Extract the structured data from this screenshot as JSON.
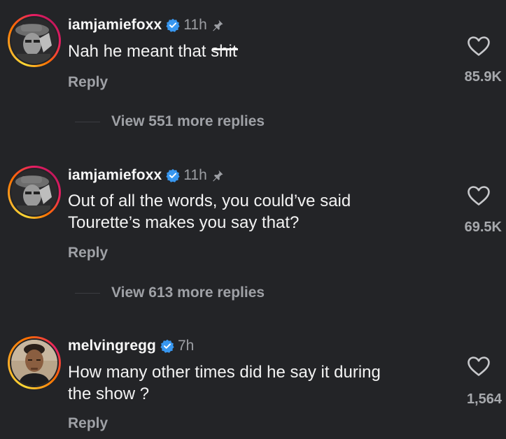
{
  "comments": [
    {
      "username": "iamjamiefoxx",
      "time": "11h",
      "pinned": true,
      "text_before": "Nah he meant that ",
      "text_censored": "shit",
      "text_lines": [],
      "reply_label": "Reply",
      "likes": "85.9K",
      "view_replies": "View 551 more replies"
    },
    {
      "username": "iamjamiefoxx",
      "time": "11h",
      "pinned": true,
      "text_lines": [
        "Out of all the words, you could’ve said",
        "Tourette’s makes you say that?"
      ],
      "reply_label": "Reply",
      "likes": "69.5K",
      "view_replies": "View 613 more replies"
    },
    {
      "username": "melvingregg",
      "time": "7h",
      "pinned": false,
      "text_lines": [
        "How many other times did he say it during",
        "the show ?"
      ],
      "reply_label": "Reply",
      "likes": "1,564"
    }
  ],
  "colors": {
    "background": "#232427",
    "verified": "#3897f0",
    "muted_text": "#9fa1a6"
  },
  "icons": {
    "verified": "verified-badge-icon",
    "pin": "pin-icon",
    "like": "heart-icon"
  }
}
